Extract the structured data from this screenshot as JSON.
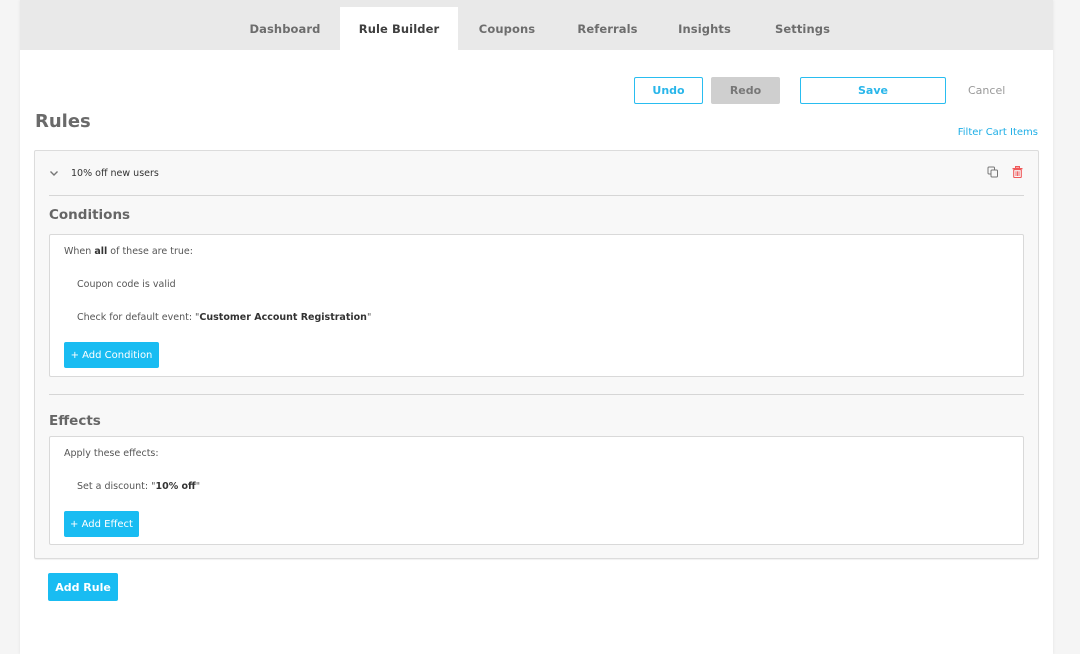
{
  "nav": {
    "tabs": [
      {
        "label": "Dashboard",
        "active": false
      },
      {
        "label": "Rule Builder",
        "active": true
      },
      {
        "label": "Coupons",
        "active": false
      },
      {
        "label": "Referrals",
        "active": false
      },
      {
        "label": "Insights",
        "active": false
      },
      {
        "label": "Settings",
        "active": false
      }
    ]
  },
  "toolbar": {
    "undo_label": "Undo",
    "redo_label": "Redo",
    "save_label": "Save",
    "cancel_label": "Cancel"
  },
  "page": {
    "title": "Rules",
    "filter_link": "Filter Cart Items"
  },
  "rule": {
    "name": "10% off new users",
    "icons": {
      "collapse": "chevron-down-icon",
      "copy": "copy-icon",
      "delete": "trash-icon"
    },
    "conditions": {
      "title": "Conditions",
      "intro_prefix": "When ",
      "intro_bold": "all",
      "intro_suffix": " of these are true:",
      "items": [
        {
          "prefix": "Coupon code is valid",
          "bold": "",
          "suffix": ""
        },
        {
          "prefix": "Check for default event: \"",
          "bold": "Customer Account Registration",
          "suffix": "\""
        }
      ],
      "add_label": "+ Add Condition"
    },
    "effects": {
      "title": "Effects",
      "intro": "Apply these effects:",
      "items": [
        {
          "prefix": "Set a discount: \"",
          "bold": "10% off",
          "suffix": "\""
        }
      ],
      "add_label": "+ Add Effect"
    }
  },
  "add_rule_label": "Add Rule",
  "colors": {
    "accent": "#19bcf2",
    "link": "#1eaee6",
    "delete": "#f0595a",
    "nav_bg": "#e9e9e9",
    "page_bg": "#f5f5f5"
  }
}
